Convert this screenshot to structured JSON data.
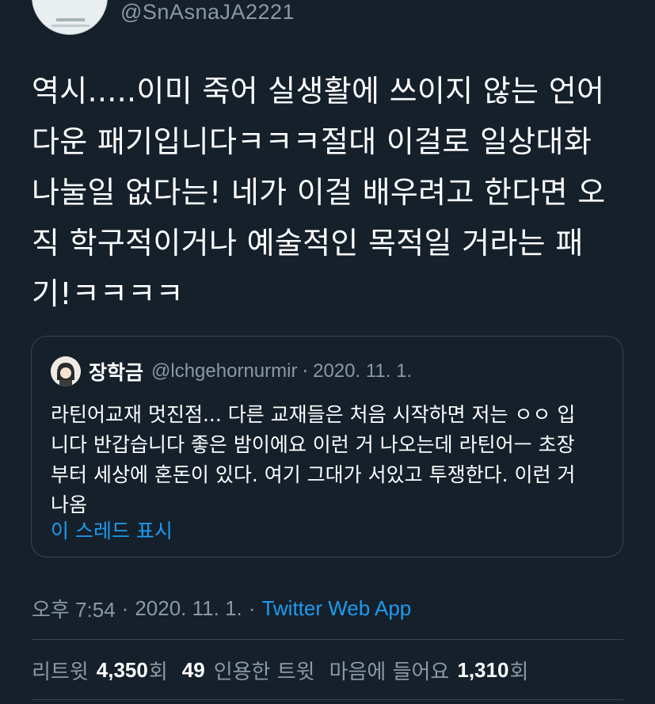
{
  "author": {
    "handle": "@SnAsnaJA2221",
    "avatar_icon": "teacup-avatar-icon"
  },
  "tweet": {
    "text": "역시.....이미 죽어 실생활에 쓰이지 않는 언어\n다운 패기입니다ㅋㅋㅋ절대 이걸로 일상대화\n나눌일 없다는! 네가 이걸 배우려고 한다면 오\n직 학구적이거나 예술적인 목적일 거라는 패\n기!ㅋㅋㅋㅋ"
  },
  "quote": {
    "name": "장학금",
    "handle": "@lchgehornurmir",
    "separator": "·",
    "date": "2020. 11. 1.",
    "text": "라틴어교재 멋진점... 다른 교재들은 처음 시작하면 저는 ㅇㅇ 입\n니다 반갑습니다 좋은 밤이에요 이런 거 나오는데 라틴어ㅡ 초장\n부터 세상에 혼돈이 있다. 여기 그대가 서있고 투쟁한다. 이런 거\n나옴",
    "show_thread": "이 스레드 표시"
  },
  "meta": {
    "time": "오후 7:54",
    "sep1": "·",
    "date": "2020. 11. 1.",
    "sep2": "·",
    "app": "Twitter Web App"
  },
  "stats": {
    "retweets_label": "리트윗",
    "retweets_count": "4,350",
    "retweets_suffix": "회",
    "quotes_count": "49",
    "quotes_label": "인용한 트윗",
    "likes_label": "마음에 들어요",
    "likes_count": "1,310",
    "likes_suffix": "회"
  },
  "colors": {
    "background": "#15202b",
    "secondary_text": "#8b98a5",
    "link": "#1d9bf0",
    "border": "#38444d"
  }
}
